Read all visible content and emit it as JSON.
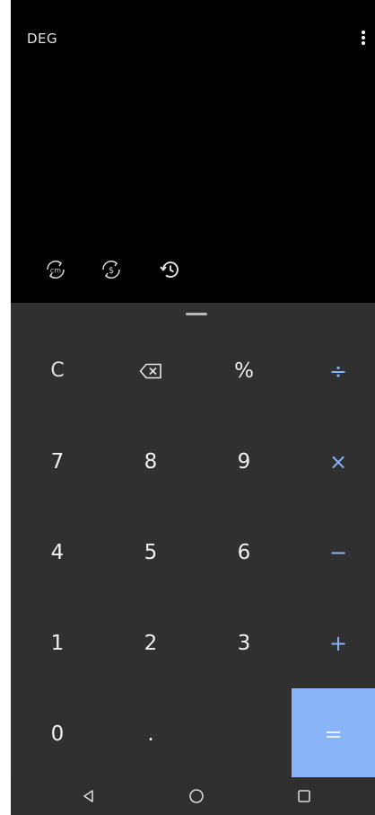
{
  "display": {
    "angle_mode": "DEG",
    "menu_icon": "more-vert-icon",
    "tools": [
      {
        "name": "unit-converter",
        "icon": "unit-convert-icon",
        "icon_text": "cm"
      },
      {
        "name": "currency-converter",
        "icon": "currency-convert-icon",
        "icon_text": "$"
      },
      {
        "name": "history",
        "icon": "history-icon"
      }
    ]
  },
  "keypad": {
    "row1": [
      "C",
      "⌫",
      "%",
      "÷"
    ],
    "row2": [
      "7",
      "8",
      "9",
      "×"
    ],
    "row3": [
      "4",
      "5",
      "6",
      "−"
    ],
    "row4": [
      "1",
      "2",
      "3",
      "+"
    ],
    "row5": [
      "0",
      ".",
      "",
      "="
    ]
  },
  "navbar": {
    "back_icon": "back-triangle-icon",
    "home_icon": "home-circle-icon",
    "recents_icon": "recents-square-icon"
  },
  "colors": {
    "display_bg": "#000000",
    "keypad_bg": "#303030",
    "accent": "#8ab4f8",
    "text": "#f0f0f0"
  }
}
